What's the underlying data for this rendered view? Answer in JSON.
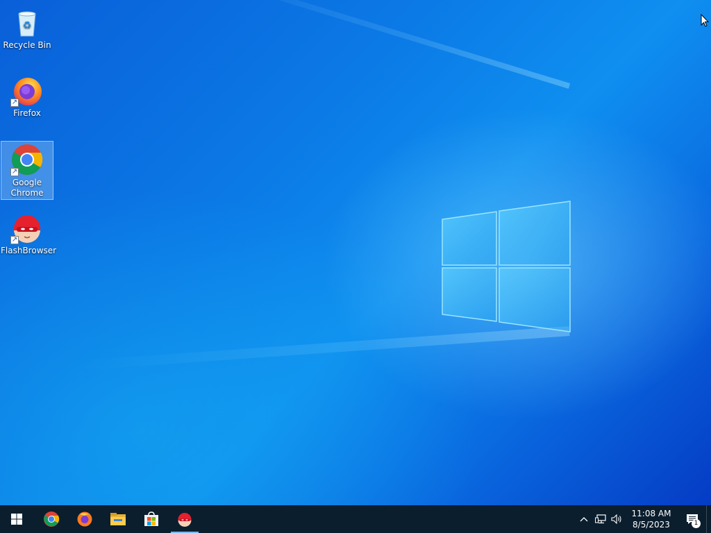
{
  "desktop": {
    "icons": [
      {
        "label": "Recycle Bin",
        "icon": "recycle-bin-icon"
      },
      {
        "label": "Firefox",
        "icon": "firefox-icon"
      },
      {
        "label": "Google Chrome",
        "icon": "chrome-icon"
      },
      {
        "label": "FlashBrowser",
        "icon": "flashbrowser-icon"
      }
    ]
  },
  "taskbar": {
    "start_icon": "windows-start-icon",
    "pinned": [
      {
        "icon": "chrome-icon",
        "active": false
      },
      {
        "icon": "firefox-icon",
        "active": false
      },
      {
        "icon": "file-explorer-icon",
        "active": false
      },
      {
        "icon": "microsoft-store-icon",
        "active": false
      },
      {
        "icon": "flashbrowser-icon",
        "active": true
      }
    ],
    "tray": {
      "chevron_icon": "chevron-up-icon",
      "network_icon": "network-icon",
      "volume_icon": "volume-icon",
      "time": "11:08 AM",
      "date": "8/5/2023",
      "notification_count": "1"
    }
  },
  "colors": {
    "taskbar": "#0b1e2e",
    "active_indicator": "#76b9ed",
    "desktop_blue": "#0b7ae6"
  }
}
